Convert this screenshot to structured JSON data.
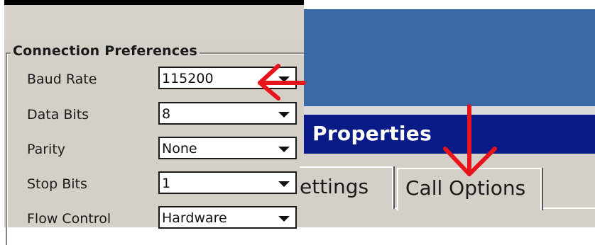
{
  "connection_preferences": {
    "title": "Connection Preferences",
    "fields": [
      {
        "label": "Baud Rate",
        "value": "115200"
      },
      {
        "label": "Data Bits",
        "value": "8"
      },
      {
        "label": "Parity",
        "value": "None"
      },
      {
        "label": "Stop Bits",
        "value": "1"
      },
      {
        "label": "Flow Control",
        "value": "Hardware"
      }
    ]
  },
  "properties_window": {
    "title": "Properties",
    "tabs": [
      {
        "label": "ettings"
      },
      {
        "label": "Call Options"
      }
    ]
  },
  "annotations": {
    "arrow_color": "#e8141b",
    "title_bar_color": "#0a1a86",
    "desktop_color": "#3a69a5"
  }
}
